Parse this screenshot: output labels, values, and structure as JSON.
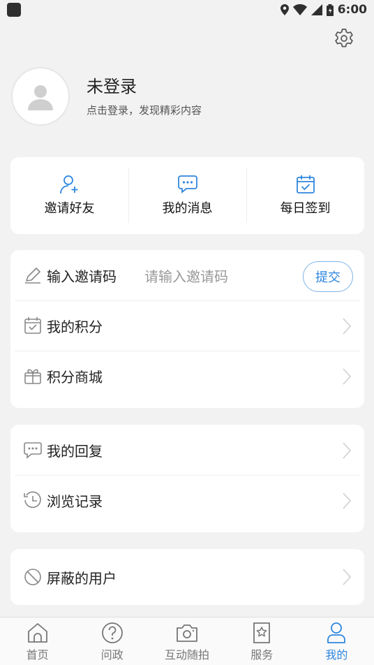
{
  "status_bar": {
    "time": "6:00"
  },
  "profile": {
    "name": "未登录",
    "subtitle": "点击登录，发现精彩内容"
  },
  "quick_actions": [
    {
      "label": "邀请好友",
      "icon": "add-user-icon"
    },
    {
      "label": "我的消息",
      "icon": "message-icon"
    },
    {
      "label": "每日签到",
      "icon": "calendar-check-icon"
    }
  ],
  "invite": {
    "label": "输入邀请码",
    "placeholder": "请输入邀请码",
    "submit_label": "提交"
  },
  "group1": [
    {
      "label": "我的积分",
      "icon": "points-calendar-icon"
    },
    {
      "label": "积分商城",
      "icon": "gift-icon"
    }
  ],
  "group2": [
    {
      "label": "我的回复",
      "icon": "reply-icon"
    },
    {
      "label": "浏览记录",
      "icon": "history-icon"
    }
  ],
  "group3": [
    {
      "label": "屏蔽的用户",
      "icon": "block-icon"
    }
  ],
  "bottom_nav": [
    {
      "label": "首页",
      "icon": "home-icon",
      "active": false
    },
    {
      "label": "问政",
      "icon": "question-icon",
      "active": false
    },
    {
      "label": "互动随拍",
      "icon": "camera-icon",
      "active": false
    },
    {
      "label": "服务",
      "icon": "star-bookmark-icon",
      "active": false
    },
    {
      "label": "我的",
      "icon": "user-icon",
      "active": true
    }
  ],
  "colors": {
    "accent": "#2e86de",
    "background": "#f2f2f2"
  }
}
